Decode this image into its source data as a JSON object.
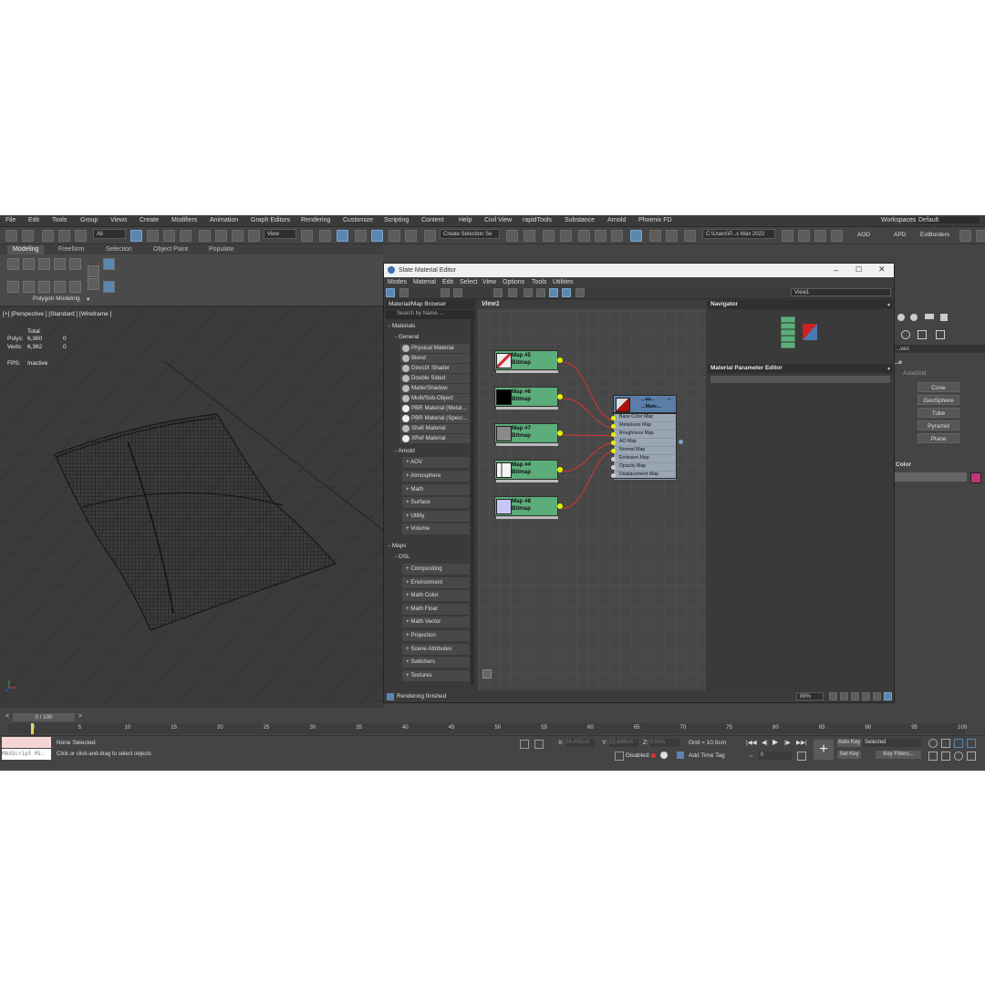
{
  "menubar": {
    "items": [
      "File",
      "Edit",
      "Tools",
      "Group",
      "Views",
      "Create",
      "Modifiers",
      "Animation",
      "Graph Editors",
      "Rendering",
      "Customize",
      "Scripting",
      "Content",
      "Help",
      "Civil View",
      "rapidTools",
      "Substance",
      "Arnold",
      "Phoenix FD"
    ],
    "workspaces_label": "Workspaces:",
    "workspaces_value": "Default"
  },
  "toolbar": {
    "filter_value": "All",
    "coord_value": "View",
    "selection_set": "Create Selection Se",
    "project_path": "C:\\Users\\P...s Max 2022",
    "right_labels": [
      "AOD",
      "APD",
      "ExtBorders"
    ]
  },
  "ribbon": {
    "tabs": [
      "Modeling",
      "Freeform",
      "Selection",
      "Object Paint",
      "Populate"
    ],
    "panel_label": "Polygon Modeling"
  },
  "viewport": {
    "label": "[+] [Perspective ] [Standard ] [Wireframe ]",
    "stats_header": "Total",
    "polys_label": "Polys:",
    "polys_value": "6,360",
    "polys_sel": "0",
    "verts_label": "Verts:",
    "verts_value": "6,362",
    "verts_sel": "0",
    "fps_label": "FPS:",
    "fps_value": "Inactive"
  },
  "sme": {
    "title": "Slate Material Editor",
    "menu": [
      "Modes",
      "Material",
      "Edit",
      "Select",
      "View",
      "Options",
      "Tools",
      "Utilities"
    ],
    "view_dropdown": "View1",
    "browser": {
      "title": "Material/Map Browser",
      "search_placeholder": "Search by Name ...",
      "materials_header": "- Materials",
      "general_header": "- General",
      "general_items": [
        "Physical Material",
        "Blend",
        "DirectX Shader",
        "Double Sided",
        "Matte/Shadow",
        "Multi/Sub-Object",
        "PBR Material (Metal...",
        "PBR Material (Spec/...",
        "Shell Material",
        "XRef Material"
      ],
      "arnold_header": "- Arnold",
      "arnold_items": [
        "+ AOV",
        "+ Atmosphere",
        "+ Math",
        "+ Surface",
        "+ Utility",
        "+ Volume"
      ],
      "maps_header": "- Maps",
      "osl_header": "- OSL",
      "osl_items": [
        "+ Compositing",
        "+ Environment",
        "+ Math Color",
        "+ Math Float",
        "+ Math Vector",
        "+ Projection",
        "+ Scene Attributes",
        "+ Switchers",
        "+ Textures"
      ]
    },
    "view_tab": "View1",
    "nodes": [
      {
        "title": "Map #5",
        "type": "Bitmap"
      },
      {
        "title": "Map #6",
        "type": "Bitmap"
      },
      {
        "title": "Map #7",
        "type": "Bitmap"
      },
      {
        "title": "Map #4",
        "type": "Bitmap"
      },
      {
        "title": "Map #8",
        "type": "Bitmap"
      }
    ],
    "pbr_node": {
      "title": "...as...",
      "subtitle": "...Mate...",
      "slots": [
        "Base Color Map",
        "Metalness Map",
        "Roughness Map",
        "AO Map",
        "Normal Map",
        "Emission Map",
        "Opacity Map",
        "Displacement Map"
      ]
    },
    "navigator_title": "Navigator",
    "param_editor_title": "Material Parameter Editor",
    "status": "Rendering finished",
    "zoom": "89%"
  },
  "command_panel": {
    "dropdown": "...ves",
    "section": "...e",
    "autogrid": "AutoGrid",
    "buttons": [
      "Cone",
      "GeoSphere",
      "Tube",
      "Pyramid",
      "Plane"
    ],
    "color_label": "Color",
    "color_swatch": "#c0337a"
  },
  "timeline": {
    "frame_display": "0 / 100",
    "ticks": [
      "0",
      "5",
      "10",
      "15",
      "20",
      "25",
      "30",
      "35",
      "40",
      "45",
      "50",
      "55",
      "60",
      "65",
      "70",
      "75",
      "80",
      "85",
      "90",
      "95",
      "100"
    ]
  },
  "status": {
    "maxscript": "MAXScript Mi:",
    "selection": "None Selected",
    "prompt": "Click or click-and-drag to select objects",
    "x_label": "X:",
    "x_value": "24.405cm",
    "y_label": "Y:",
    "y_value": "23.648cm",
    "z_label": "Z:",
    "z_value": "0.0cm",
    "grid": "Grid = 10.0cm",
    "disabled": "Disabled:",
    "add_time_tag": "Add Time Tag",
    "auto_key": "Auto Key",
    "selected": "Selected",
    "set_key": "Set Key",
    "key_filters": "Key Filters...",
    "frame": "0"
  }
}
